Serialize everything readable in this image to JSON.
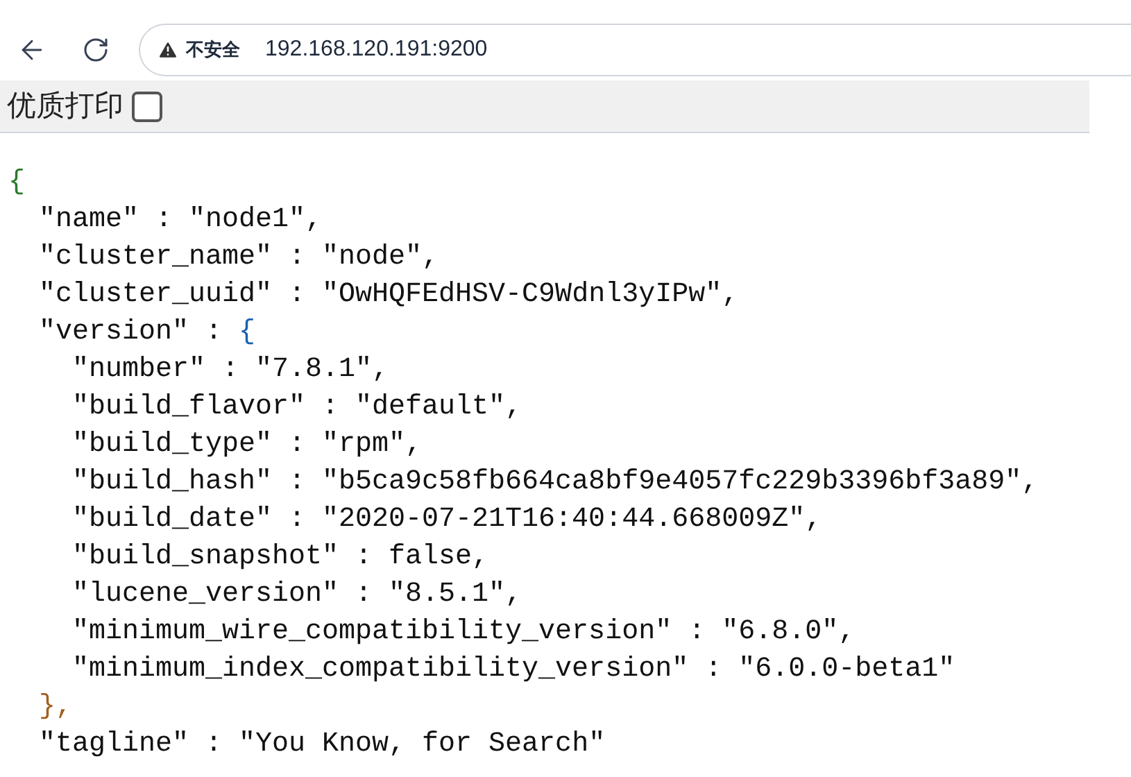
{
  "browser": {
    "security_label": "不安全",
    "url": "192.168.120.191:9200"
  },
  "toolbar": {
    "label": "优质打印",
    "checkbox": {
      "checked": false
    }
  },
  "document": {
    "open": {
      "text": "{",
      "color": "#2a7a2a"
    },
    "entries": [
      {
        "text": "\"name\" : \"node1\","
      },
      {
        "text": "\"cluster_name\" : \"node\","
      },
      {
        "text": "\"cluster_uuid\" : \"OwHQFEdHSV-C9Wdnl3yIPw\","
      },
      {
        "text": "\"version\" : ",
        "open": {
          "text": "{",
          "color": "#1a5fb4"
        },
        "close": {
          "text": "},",
          "color": "#a0601e"
        },
        "children": [
          {
            "text": "\"number\" : \"7.8.1\","
          },
          {
            "text": "\"build_flavor\" : \"default\","
          },
          {
            "text": "\"build_type\" : \"rpm\","
          },
          {
            "text": "\"build_hash\" : \"b5ca9c58fb664ca8bf9e4057fc229b3396bf3a89\","
          },
          {
            "text": "\"build_date\" : \"2020-07-21T16:40:44.668009Z\","
          },
          {
            "text": "\"build_snapshot\" : false,"
          },
          {
            "text": "\"lucene_version\" : \"8.5.1\","
          },
          {
            "text": "\"minimum_wire_compatibility_version\" : \"6.8.0\","
          },
          {
            "text": "\"minimum_index_compatibility_version\" : \"6.0.0-beta1\""
          }
        ]
      },
      {
        "text": "\"tagline\" : \"You Know, for Search\""
      }
    ]
  }
}
